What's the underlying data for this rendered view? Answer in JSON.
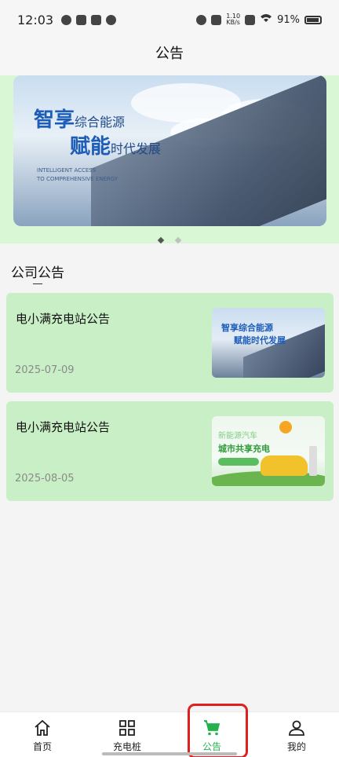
{
  "status_bar": {
    "time": "12:03",
    "net_speed_value": "1.10",
    "net_speed_unit": "KB/s",
    "battery": "91%"
  },
  "header": {
    "title": "公告"
  },
  "banner": {
    "line1_big": "智享",
    "line1_small": "综合能源",
    "line2_big": "赋能",
    "line2_small": "时代发展",
    "subtitle_1": "INTELLIGENT ACCESS",
    "subtitle_2": "TO COMPREHENSIVE ENERGY",
    "active_dot_color": "#555555",
    "inactive_dot_color": "#bfbfbf"
  },
  "section": {
    "title": "公司公告"
  },
  "announcements": [
    {
      "title": "电小满充电站公告",
      "date": "2025-07-09",
      "thumb_line1": "智享综合能源",
      "thumb_line2": "赋能时代发展"
    },
    {
      "title": "电小满充电站公告",
      "date": "2025-08-05",
      "thumb_line1": "新能源汽车",
      "thumb_line2": "城市共享充电"
    }
  ],
  "tabs": [
    {
      "label": "首页",
      "icon": "home-icon"
    },
    {
      "label": "充电桩",
      "icon": "grid-icon"
    },
    {
      "label": "公告",
      "icon": "cart-icon",
      "active": true
    },
    {
      "label": "我的",
      "icon": "user-icon"
    }
  ],
  "colors": {
    "accent": "#22b34c",
    "banner_bg": "#d9f7d4",
    "card_bg": "#c9efc6",
    "highlight": "#e02020"
  }
}
